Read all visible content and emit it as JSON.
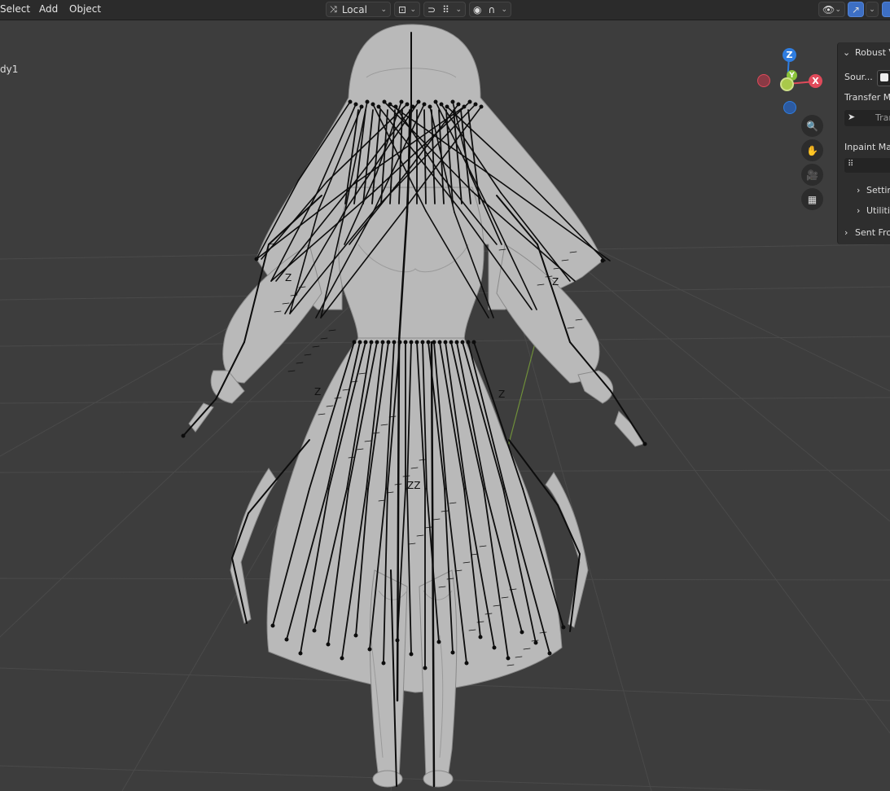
{
  "header": {
    "menu": [
      "Select",
      "Add",
      "Object"
    ],
    "orientation": {
      "value": "Local",
      "icon": "transform-orientation-icon"
    },
    "pivot_icon": "pivot-point-icon",
    "snap_icons": [
      "snap-magnet-icon",
      "snap-increment-icon"
    ],
    "proportional_icons": [
      "proportional-edit-icon",
      "falloff-curve-icon"
    ],
    "visibility_icon": "eye-icon",
    "gizmo_toggle_icon": "gizmo-toggle-icon"
  },
  "viewport": {
    "object_name_fragment": "dy1",
    "grid_color": "#4a4a4a",
    "background_color": "#3d3d3d",
    "model_color": "#b9b9b9",
    "bone_color": "#0d0d0d"
  },
  "nav_gizmo": {
    "axes": {
      "z": "Z",
      "x": "X",
      "y": "Y"
    },
    "colors": {
      "x": "#e04a5a",
      "y": "#8ac43a",
      "z": "#2f7de0"
    },
    "buttons": [
      "zoom-icon",
      "hand-pan-icon",
      "camera-icon",
      "grid-perspective-icon"
    ]
  },
  "sidebar": {
    "panel_title": "Robust V",
    "source_label": "Sour...",
    "transfer_label": "Transfer M",
    "transfer_button": "Tran",
    "inpaint_label": "Inpaint Ma",
    "subpanels": [
      "Settin",
      "Utilitie"
    ],
    "sent_from": "Sent Fro"
  }
}
